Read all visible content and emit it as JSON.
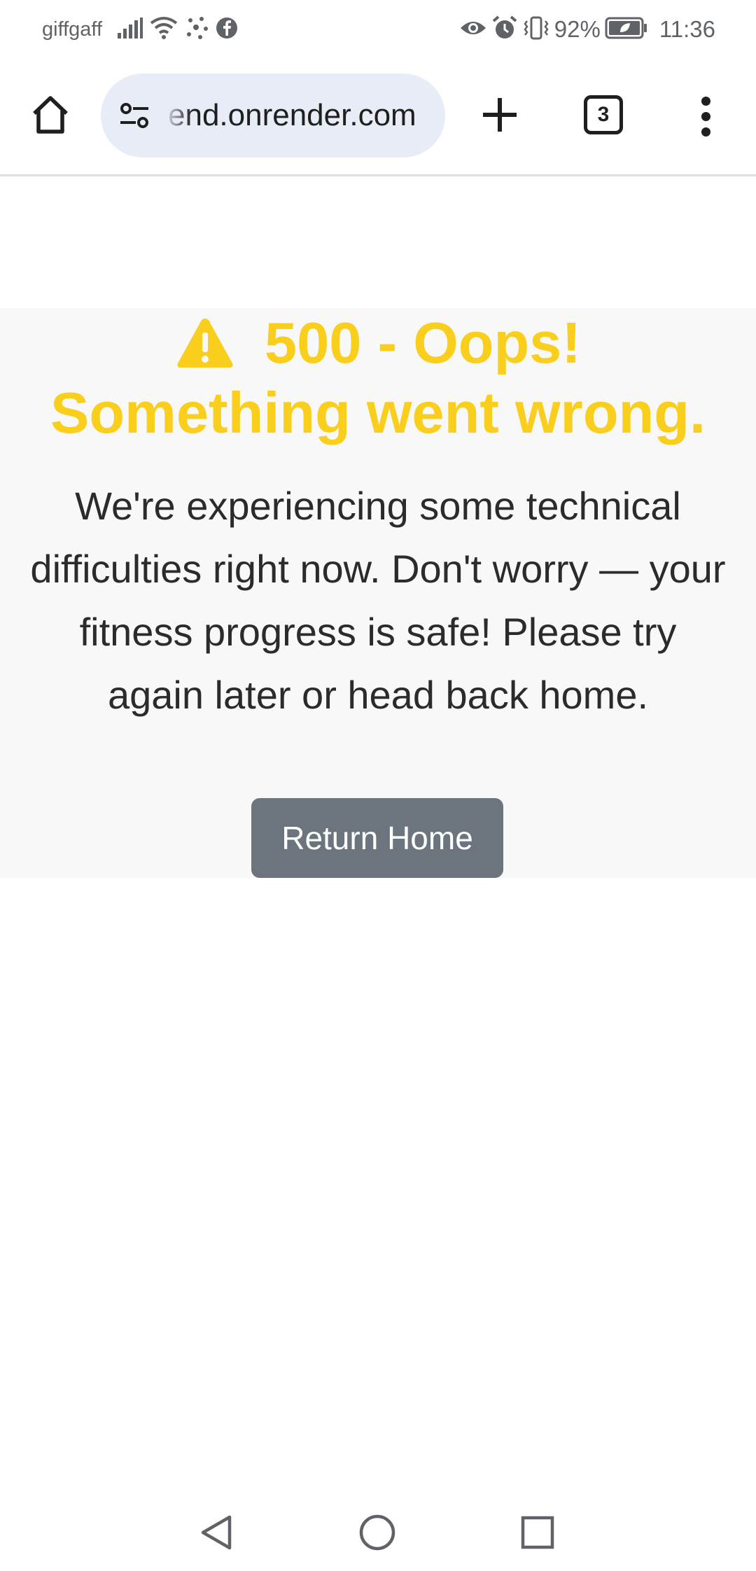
{
  "status_bar": {
    "carrier": "giffgaff",
    "battery": "92%",
    "time": "11:36",
    "icons": [
      "signal-icon",
      "wifi-icon",
      "dots-icon",
      "facebook-icon",
      "eye-icon",
      "alarm-icon",
      "vibrate-icon",
      "battery-icon"
    ]
  },
  "browser": {
    "url": "end.onrender.com",
    "tab_count": "3",
    "icons": [
      "home-icon",
      "site-settings-icon",
      "plus-icon",
      "tab-switcher-icon",
      "more-vert-icon"
    ]
  },
  "error": {
    "title_line1": "500 - Oops!",
    "title_line2": "Something went wrong.",
    "message": "We're experiencing some technical difficulties right now. Don't worry — your fitness progress is safe! Please try again later or head back home.",
    "button_label": "Return Home",
    "accent_color": "#f9ce1d",
    "button_color": "#6c757d"
  },
  "nav_bar": {
    "icons": [
      "back-icon",
      "home-circle-icon",
      "recents-icon"
    ]
  }
}
